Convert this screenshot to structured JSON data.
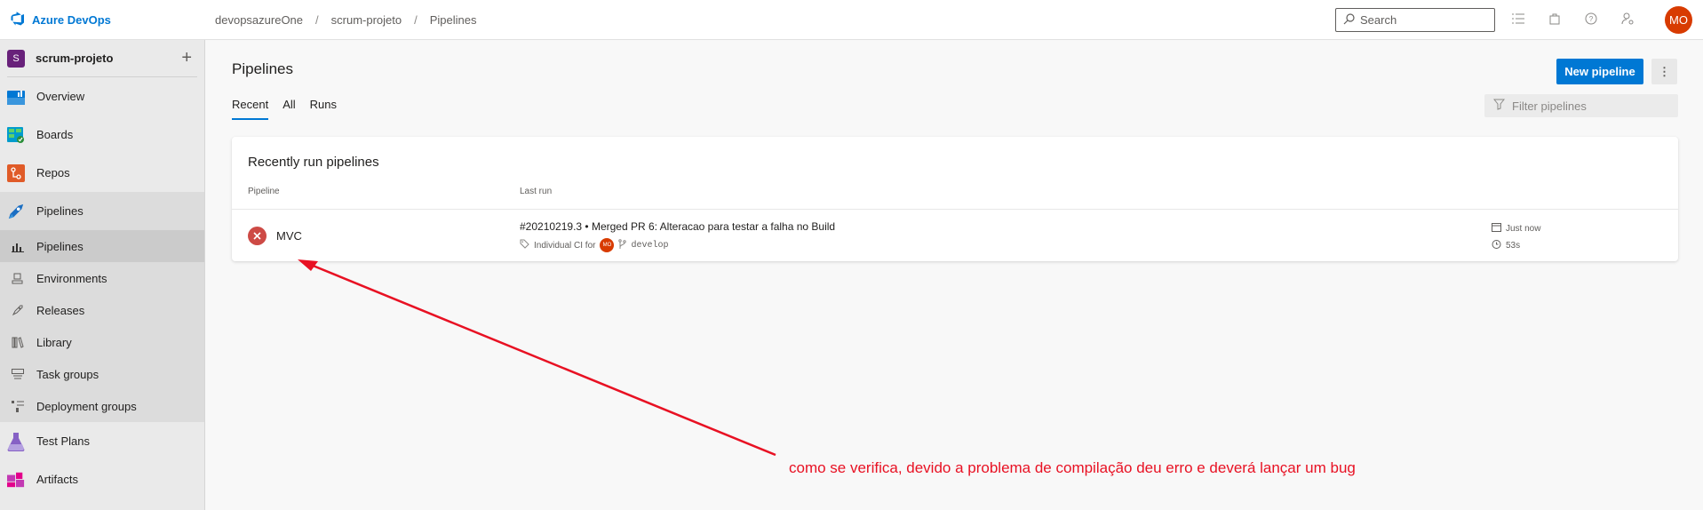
{
  "topbar": {
    "brand": "Azure DevOps",
    "breadcrumb": [
      "devopsazureOne",
      "scrum-projeto",
      "Pipelines"
    ],
    "search_placeholder": "Search",
    "avatar_initials": "MO"
  },
  "sidebar": {
    "project_initial": "S",
    "project_name": "scrum-projeto",
    "items": [
      {
        "label": "Overview"
      },
      {
        "label": "Boards"
      },
      {
        "label": "Repos"
      },
      {
        "label": "Pipelines"
      }
    ],
    "sub_items": [
      {
        "label": "Pipelines"
      },
      {
        "label": "Environments"
      },
      {
        "label": "Releases"
      },
      {
        "label": "Library"
      },
      {
        "label": "Task groups"
      },
      {
        "label": "Deployment groups"
      }
    ],
    "bottom_items": [
      {
        "label": "Test Plans"
      },
      {
        "label": "Artifacts"
      }
    ]
  },
  "main": {
    "title": "Pipelines",
    "tabs": [
      {
        "label": "Recent",
        "active": true
      },
      {
        "label": "All",
        "active": false
      },
      {
        "label": "Runs",
        "active": false
      }
    ],
    "new_pipeline_label": "New pipeline",
    "more_label": "⋮",
    "filter_placeholder": "Filter pipelines",
    "card": {
      "title": "Recently run pipelines",
      "col_pipeline": "Pipeline",
      "col_last_run": "Last run",
      "row": {
        "name": "MVC",
        "status": "failed",
        "run_title": "#20210219.3 • Merged PR 6: Alteracao para testar a falha no Build",
        "trigger": "Individual CI for",
        "avatar_initials": "MO",
        "branch": "develop",
        "when": "Just now",
        "duration": "53s"
      }
    }
  },
  "annotation": {
    "text": "como se verifica, devido a problema de compilação deu erro e deverá lançar um bug",
    "color": "#e81123"
  },
  "colors": {
    "accent": "#0078d4",
    "failed": "#cd4a45",
    "avatar": "#d83b01",
    "project": "#68217a"
  }
}
